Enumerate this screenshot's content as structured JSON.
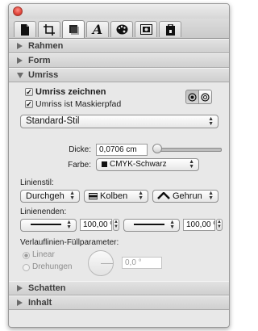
{
  "tabs": [
    {
      "icon": "document-icon"
    },
    {
      "icon": "crop-frame-icon"
    },
    {
      "icon": "shape-square-icon"
    },
    {
      "icon": "text-format-icon"
    },
    {
      "icon": "palette-icon"
    },
    {
      "icon": "image-frame-icon"
    },
    {
      "icon": "lock-icon"
    }
  ],
  "sections": {
    "rahmen": "Rahmen",
    "form": "Form",
    "umriss": "Umriss",
    "schatten": "Schatten",
    "inhalt": "Inhalt"
  },
  "umriss": {
    "draw_outline_label": "Umriss zeichnen",
    "draw_outline_checked": true,
    "mask_path_label": "Umriss ist Maskierpfad",
    "mask_path_checked": true,
    "style_value": "Standard-Stil",
    "thickness_label": "Dicke:",
    "thickness_value": "0,0706 cm",
    "color_label": "Farbe:",
    "color_value": "CMYK-Schwarz",
    "color_swatch": "#111111",
    "linestyle_label": "Linienstil:",
    "linestyle_values": [
      "Durchgeh",
      "Kolben",
      "Gehrun"
    ],
    "lineends_label": "Linienenden:",
    "lineend_left_percent": "100,00 %",
    "lineend_right_percent": "100,00 %",
    "gradient_label": "Verlauflinien-Füllparameter:",
    "radio_linear": "Linear",
    "radio_rotation": "Drehungen",
    "angle_value": "0,0 °"
  }
}
